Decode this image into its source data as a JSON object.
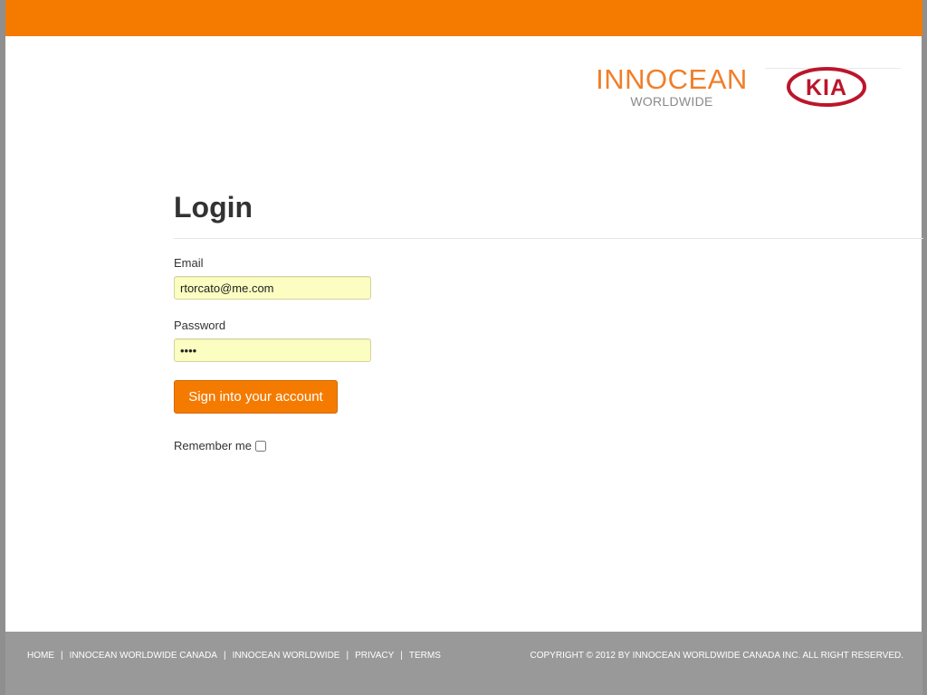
{
  "brand": {
    "innocean_main": "INNOCEAN",
    "innocean_sub": "WORLDWIDE",
    "kia_text": "KIA",
    "accent_color": "#f57b00",
    "kia_red": "#bb162b"
  },
  "login": {
    "title": "Login",
    "email_label": "Email",
    "email_value": "rtorcato@me.com",
    "password_label": "Password",
    "password_value": "••••",
    "submit_label": "Sign into your account",
    "remember_label": "Remember me",
    "remember_checked": false
  },
  "footer": {
    "nav": [
      "HOME",
      "INNOCEAN WORLDWIDE CANADA",
      "INNOCEAN WORLDWIDE",
      "PRIVACY",
      "TERMS"
    ],
    "separator": "|",
    "copyright": "COPYRIGHT © 2012 BY INNOCEAN WORLDWIDE CANADA INC. ALL RIGHT RESERVED."
  },
  "icons": [
    "checkbox-icon",
    "kia-logo-icon",
    "innocean-logo-icon"
  ]
}
